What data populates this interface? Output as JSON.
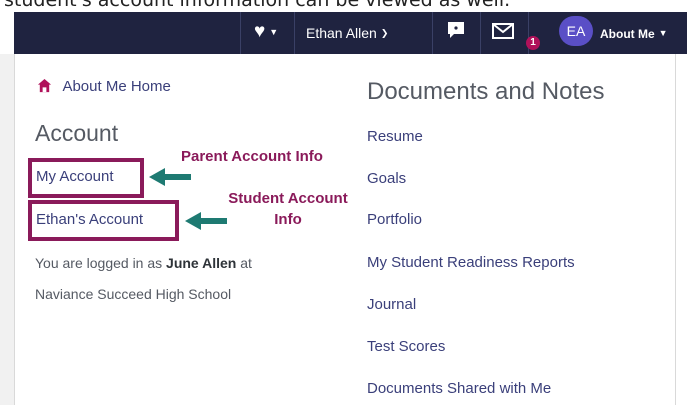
{
  "caption": "student's account information can be viewed as well.",
  "topbar": {
    "user_name": "Ethan Allen",
    "avatar_initials": "EA",
    "about_me_label": "About Me",
    "notification_count": "1"
  },
  "menu": {
    "home_label": "About Me Home",
    "account_heading": "Account",
    "my_account": "My Account",
    "student_account": "Ethan's Account",
    "logged_in_prefix": "You are logged in as",
    "logged_in_name": "June Allen",
    "logged_in_at": "at",
    "school": "Naviance Succeed High School",
    "documents_heading": "Documents and Notes",
    "documents_items": [
      "Resume",
      "Goals",
      "Portfolio",
      "My Student Readiness Reports",
      "Journal",
      "Test Scores",
      "Documents Shared with Me"
    ]
  },
  "annotations": {
    "parent_info": "Parent Account Info",
    "student_info_line1": "Student Account",
    "student_info_line2": "Info"
  },
  "colors": {
    "topbar": "#1f2340",
    "highlight": "#8a1a5a",
    "arrow": "#1e7a72",
    "link": "#3a3f7a"
  }
}
